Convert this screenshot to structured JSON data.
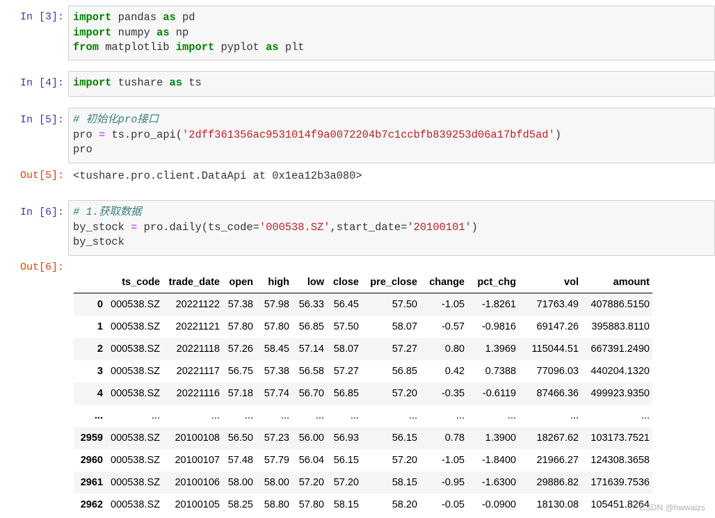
{
  "cells": [
    {
      "prompt": "In  [3]:",
      "lines": [
        [
          [
            "kw",
            "import"
          ],
          [
            "t",
            " pandas "
          ],
          [
            "kw",
            "as"
          ],
          [
            "t",
            " pd"
          ]
        ],
        [
          [
            "kw",
            "import"
          ],
          [
            "t",
            " numpy "
          ],
          [
            "kw",
            "as"
          ],
          [
            "t",
            " np"
          ]
        ],
        [
          [
            "kw",
            "from"
          ],
          [
            "t",
            " matplotlib "
          ],
          [
            "kw",
            "import"
          ],
          [
            "t",
            " pyplot "
          ],
          [
            "kw",
            "as"
          ],
          [
            "t",
            " plt"
          ]
        ]
      ]
    },
    {
      "prompt": "In  [4]:",
      "lines": [
        [
          [
            "kw",
            "import"
          ],
          [
            "t",
            " tushare "
          ],
          [
            "kw",
            "as"
          ],
          [
            "t",
            " ts"
          ]
        ]
      ]
    },
    {
      "prompt": "In  [5]:",
      "lines": [
        [
          [
            "cm",
            "# 初始化pro接口"
          ]
        ],
        [
          [
            "t",
            "pro "
          ],
          [
            "op",
            "="
          ],
          [
            "t",
            " ts.pro_api("
          ],
          [
            "str",
            "'2dff361356ac9531014f9a0072204b7c1ccbfb839253d06a17bfd5ad'"
          ],
          [
            "t",
            ")"
          ]
        ],
        [
          [
            "t",
            "pro"
          ]
        ]
      ]
    },
    {
      "prompt": "In  [6]:",
      "lines": [
        [
          [
            "cm",
            "# 1.获取数据"
          ]
        ],
        [
          [
            "t",
            "by_stock "
          ],
          [
            "op",
            "="
          ],
          [
            "t",
            " pro.daily(ts_code="
          ],
          [
            "str",
            "'000538.SZ'"
          ],
          [
            "t",
            ",start_date="
          ],
          [
            "str",
            "'20100101'"
          ],
          [
            "t",
            ")"
          ]
        ],
        [
          [
            "t",
            "by_stock"
          ]
        ]
      ]
    }
  ],
  "outputs": {
    "out5_prompt": "Out[5]:",
    "out5_text": "<tushare.pro.client.DataApi at 0x1ea12b3a080>",
    "out6_prompt": "Out[6]:"
  },
  "dataframe": {
    "columns": [
      "",
      "ts_code",
      "trade_date",
      "open",
      "high",
      "low",
      "close",
      "pre_close",
      "change",
      "pct_chg",
      "vol",
      "amount"
    ],
    "rows": [
      [
        "0",
        "000538.SZ",
        "20221122",
        "57.38",
        "57.98",
        "56.33",
        "56.45",
        "57.50",
        "-1.05",
        "-1.8261",
        "71763.49",
        "407886.5150"
      ],
      [
        "1",
        "000538.SZ",
        "20221121",
        "57.80",
        "57.80",
        "56.85",
        "57.50",
        "58.07",
        "-0.57",
        "-0.9816",
        "69147.26",
        "395883.8110"
      ],
      [
        "2",
        "000538.SZ",
        "20221118",
        "57.26",
        "58.45",
        "57.14",
        "58.07",
        "57.27",
        "0.80",
        "1.3969",
        "115044.51",
        "667391.2490"
      ],
      [
        "3",
        "000538.SZ",
        "20221117",
        "56.75",
        "57.38",
        "56.58",
        "57.27",
        "56.85",
        "0.42",
        "0.7388",
        "77096.03",
        "440204.1320"
      ],
      [
        "4",
        "000538.SZ",
        "20221116",
        "57.18",
        "57.74",
        "56.70",
        "56.85",
        "57.20",
        "-0.35",
        "-0.6119",
        "87466.36",
        "499923.9350"
      ],
      [
        "...",
        "...",
        "...",
        "...",
        "...",
        "...",
        "...",
        "...",
        "...",
        "...",
        "...",
        "..."
      ],
      [
        "2959",
        "000538.SZ",
        "20100108",
        "56.50",
        "57.23",
        "56.00",
        "56.93",
        "56.15",
        "0.78",
        "1.3900",
        "18267.62",
        "103173.7521"
      ],
      [
        "2960",
        "000538.SZ",
        "20100107",
        "57.48",
        "57.79",
        "56.04",
        "56.15",
        "57.20",
        "-1.05",
        "-1.8400",
        "21966.27",
        "124308.3658"
      ],
      [
        "2961",
        "000538.SZ",
        "20100106",
        "58.00",
        "58.00",
        "57.20",
        "57.20",
        "58.15",
        "-0.95",
        "-1.6300",
        "29886.82",
        "171639.7536"
      ],
      [
        "2962",
        "000538.SZ",
        "20100105",
        "58.25",
        "58.80",
        "57.80",
        "58.15",
        "58.20",
        "-0.05",
        "-0.0900",
        "18130.08",
        "105451.8264"
      ]
    ]
  },
  "watermark": "CSDN @hwwaizs",
  "colors": {
    "keyword": "#008000",
    "string": "#ba2121",
    "comment": "#408080",
    "operator": "#aa22ff",
    "in_prompt": "#303f9f",
    "out_prompt": "#d84315"
  }
}
